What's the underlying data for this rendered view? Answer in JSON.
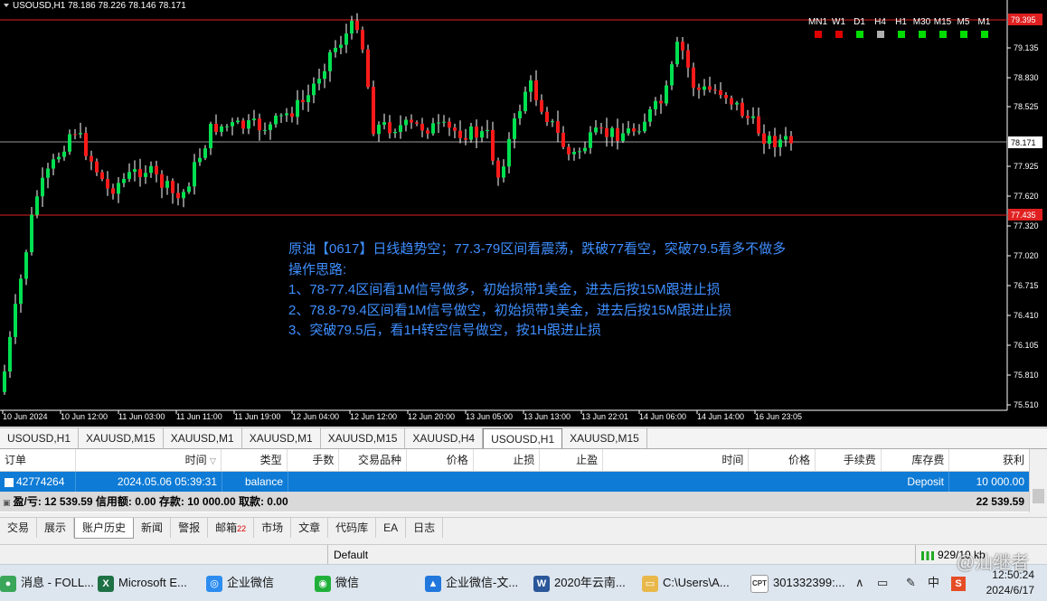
{
  "chart": {
    "header": "USOUSD,H1  78.186 78.226 78.146 78.171",
    "timeframes": [
      {
        "label": "MN1",
        "color": "#e00000"
      },
      {
        "label": "W1",
        "color": "#e00000"
      },
      {
        "label": "D1",
        "color": "#00dd00"
      },
      {
        "label": "H4",
        "color": "#b0b0b0"
      },
      {
        "label": "H1",
        "color": "#00dd00"
      },
      {
        "label": "M30",
        "color": "#00dd00"
      },
      {
        "label": "M15",
        "color": "#00dd00"
      },
      {
        "label": "M5",
        "color": "#00dd00"
      },
      {
        "label": "M1",
        "color": "#00dd00"
      }
    ],
    "price_labels": [
      "79.135",
      "78.830",
      "78.525",
      "77.925",
      "77.620",
      "77.320",
      "77.020",
      "76.715",
      "76.410",
      "76.105",
      "75.810",
      "75.510"
    ],
    "level_labels": {
      "upper": "79.395",
      "current": "78.171",
      "lower": "77.435"
    },
    "time_labels": [
      "10 Jun 2024",
      "10 Jun 12:00",
      "11 Jun 03:00",
      "11 Jun 11:00",
      "11 Jun 19:00",
      "12 Jun 04:00",
      "12 Jun 12:00",
      "12 Jun 20:00",
      "13 Jun 05:00",
      "13 Jun 13:00",
      "13 Jun 22:01",
      "14 Jun 06:00",
      "14 Jun 14:00",
      "16 Jun 23:05"
    ],
    "bull_color": "#00e050",
    "bear_color": "#ff1a1a",
    "annotation": [
      "原油【0617】日线趋势空；77.3-79区间看震荡，跌破77看空，突破79.5看多不做多",
      "操作思路:",
      "1、78-77.4区间看1M信号做多，初始损带1美金，进去后按15M跟进止损",
      "2、78.8-79.4区间看1M信号做空，初始损带1美金，进去后按15M跟进止损",
      "3、突破79.5后，看1H转空信号做空，按1H跟进止损"
    ]
  },
  "symbol_tabs": [
    "USOUSD,H1",
    "XAUUSD,M15",
    "XAUUSD,M1",
    "XAUUSD,M1",
    "XAUUSD,M15",
    "XAUUSD,H4",
    "USOUSD,H1",
    "XAUUSD,M15"
  ],
  "terminal": {
    "headers": [
      "订单",
      "时间",
      "类型",
      "手数",
      "交易品种",
      "价格",
      "止损",
      "止盈",
      "时间",
      "价格",
      "手续费",
      "库存费",
      "获利"
    ],
    "row": {
      "order": "42774264",
      "time": "2024.05.06 05:39:31",
      "type": "balance",
      "comment": "Deposit",
      "profit": "10 000.00"
    },
    "summary_left": "盈/亏: 12 539.59  信用额: 0.00  存款: 10 000.00  取款: 0.00",
    "summary_right": "22 539.59"
  },
  "bottom_tabs": [
    {
      "label": "交易"
    },
    {
      "label": "展示"
    },
    {
      "label": "账户历史"
    },
    {
      "label": "新闻"
    },
    {
      "label": "警报"
    },
    {
      "label": "邮箱",
      "badge": "22"
    },
    {
      "label": "市场"
    },
    {
      "label": "文章"
    },
    {
      "label": "代码库"
    },
    {
      "label": "EA"
    },
    {
      "label": "日志"
    }
  ],
  "status": {
    "profile": "Default",
    "traffic": "929/10 kb"
  },
  "taskbar": {
    "items": [
      "消息 - FOLL...",
      "Microsoft E...",
      "企业微信",
      "微信",
      "企业微信-文...",
      "2020年云南...",
      "C:\\Users\\A...",
      "301332399:..."
    ],
    "tray_ime": "中",
    "time": "12:50:24",
    "date": "2024/6/17",
    "watermark": "@汕继者"
  }
}
